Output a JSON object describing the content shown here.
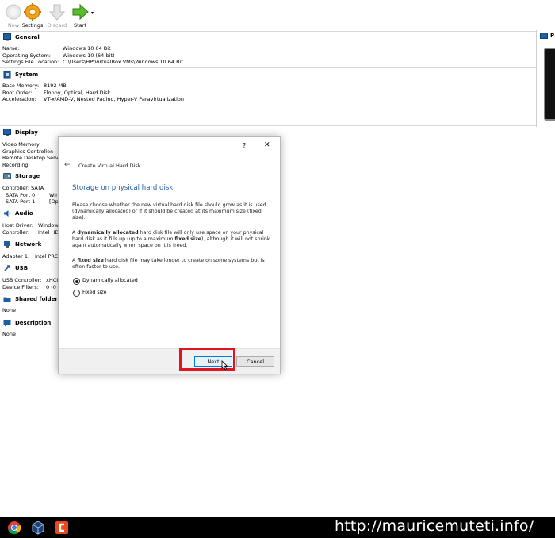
{
  "toolbar": {
    "new_label": "New",
    "settings_label": "Settings",
    "discard_label": "Discard",
    "start_label": "Start"
  },
  "sections": {
    "general": {
      "title": "General",
      "rows": [
        {
          "key": "Name:",
          "value": "Windows 10 64 Bit"
        },
        {
          "key": "Operating System:",
          "value": "Windows 10 (64-bit)"
        },
        {
          "key": "Settings File Location:",
          "value": "C:\\Users\\HP\\VirtualBox VMs\\Windows 10 64 Bit"
        }
      ]
    },
    "system": {
      "title": "System",
      "rows": [
        {
          "key": "Base Memory:",
          "value": "8192 MB"
        },
        {
          "key": "Boot Order:",
          "value": "Floppy, Optical, Hard Disk"
        },
        {
          "key": "Acceleration:",
          "value": "VT-x/AMD-V, Nested Paging, Hyper-V Paravirtualization"
        }
      ]
    },
    "display": {
      "title": "Display",
      "rows": [
        {
          "key": "Video Memory:"
        },
        {
          "key": "Graphics Controller:"
        },
        {
          "key": "Remote Desktop Serve"
        },
        {
          "key": "Recording:"
        }
      ]
    },
    "storage": {
      "title": "Storage",
      "rows": [
        {
          "key": "Controller: SATA"
        },
        {
          "key": "SATA Port 0:",
          "value": "Wir"
        },
        {
          "key": "SATA Port 1:",
          "value": "[Op"
        }
      ]
    },
    "audio": {
      "title": "Audio",
      "rows": [
        {
          "key": "Host Driver:",
          "value": "Window"
        },
        {
          "key": "Controller:",
          "value": "Intel HD"
        }
      ]
    },
    "network": {
      "title": "Network",
      "rows": [
        {
          "key": "Adapter 1:",
          "value": "Intel PRC"
        }
      ]
    },
    "usb": {
      "title": "USB",
      "rows": [
        {
          "key": "USB Controller:",
          "value": "xHCI"
        },
        {
          "key": "Device Filters:",
          "value": "0 (0 a"
        }
      ]
    },
    "shared_folders": {
      "title": "Shared folders",
      "value": "None"
    },
    "description": {
      "title": "Description",
      "value": "None"
    }
  },
  "preview": {
    "title_initial": "P"
  },
  "dialog": {
    "help_glyph": "?",
    "close_glyph": "✕",
    "back_glyph": "←",
    "wizard_title": "Create Virtual Hard Disk",
    "heading": "Storage on physical hard disk",
    "para1": "Please choose whether the new virtual hard disk file should grow as it is used (dynamically allocated) or if it should be created at its maximum size (fixed size).",
    "para2_a": "A ",
    "para2_b": "dynamically allocated",
    "para2_c": " hard disk file will only use space on your physical hard disk as it fills up (up to a maximum ",
    "para2_d": "fixed size",
    "para2_e": "), although it will not shrink again automatically when space on it is freed.",
    "para3_a": "A ",
    "para3_b": "fixed size",
    "para3_c": " hard disk file may take longer to create on some systems but is often faster to use.",
    "option_dynamic": "Dynamically allocated",
    "option_fixed": "Fixed size",
    "selected": "Dynamically allocated",
    "next_label": "Next",
    "cancel_label": "Cancel"
  },
  "taskbar": {
    "url_text": "http://mauricemuteti.info/"
  },
  "colors": {
    "highlight_red": "#e0141e",
    "heading_blue": "#1f5ea8",
    "accent_blue": "#0078d7"
  }
}
